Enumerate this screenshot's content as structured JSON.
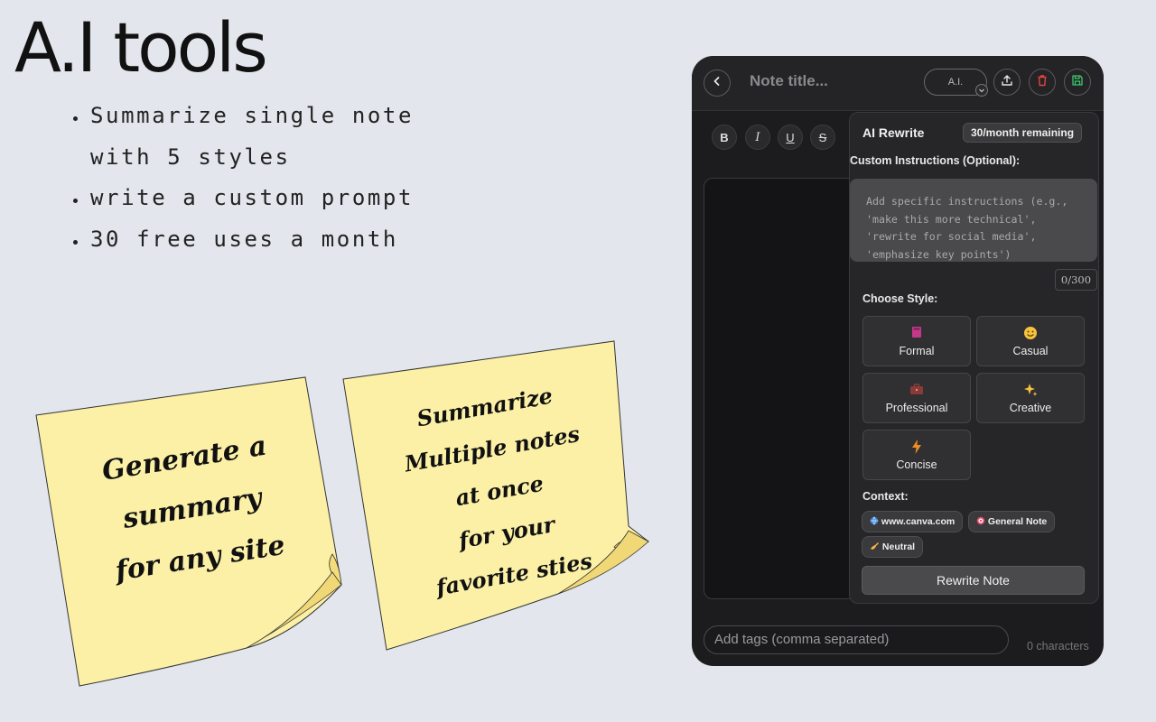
{
  "slide": {
    "headline": "A.I tools",
    "bullets": [
      "Summarize single note with 5 styles",
      "write a custom prompt",
      "30 free uses a month"
    ]
  },
  "sticky_notes": [
    {
      "lines": [
        "Generate a",
        "summary",
        "for any site"
      ]
    },
    {
      "lines": [
        "Summarize",
        "Multiple notes",
        "at once",
        "for your",
        "favorite sties"
      ]
    }
  ],
  "app": {
    "header": {
      "title_placeholder": "Note title...",
      "ai_button": "A.I.",
      "icons": {
        "back": "chevron-left-icon",
        "ai_menu": "chevron-down-icon",
        "export": "upload-icon",
        "delete": "trash-icon",
        "save": "save-icon"
      }
    },
    "format_toolbar": [
      "B",
      "I",
      "U",
      "S"
    ],
    "ai_rewrite": {
      "title": "AI Rewrite",
      "quota": "30/month remaining",
      "instructions_label": "Custom Instructions (Optional):",
      "instructions_placeholder": "Add specific instructions (e.g., 'make this more technical', 'rewrite for social media', 'emphasize key points')",
      "counter": "0/300",
      "style_label": "Choose Style:",
      "styles": [
        {
          "label": "Formal",
          "icon": "book-icon"
        },
        {
          "label": "Casual",
          "icon": "smile-icon"
        },
        {
          "label": "Professional",
          "icon": "briefcase-icon"
        },
        {
          "label": "Creative",
          "icon": "sparkles-icon"
        },
        {
          "label": "Concise",
          "icon": "lightning-icon"
        }
      ],
      "context_label": "Context:",
      "context_chips": [
        {
          "label": "www.canva.com",
          "icon": "globe-icon"
        },
        {
          "label": "General Note",
          "icon": "target-icon"
        },
        {
          "label": "Neutral",
          "icon": "writing-hand-icon"
        }
      ],
      "action": "Rewrite Note"
    },
    "tags_placeholder": "Add tags (comma separated)",
    "char_count": "0 characters",
    "colors": {
      "background": "#1c1c1e",
      "delete_accent": "#e0443e",
      "save_accent": "#3ec46d"
    }
  }
}
